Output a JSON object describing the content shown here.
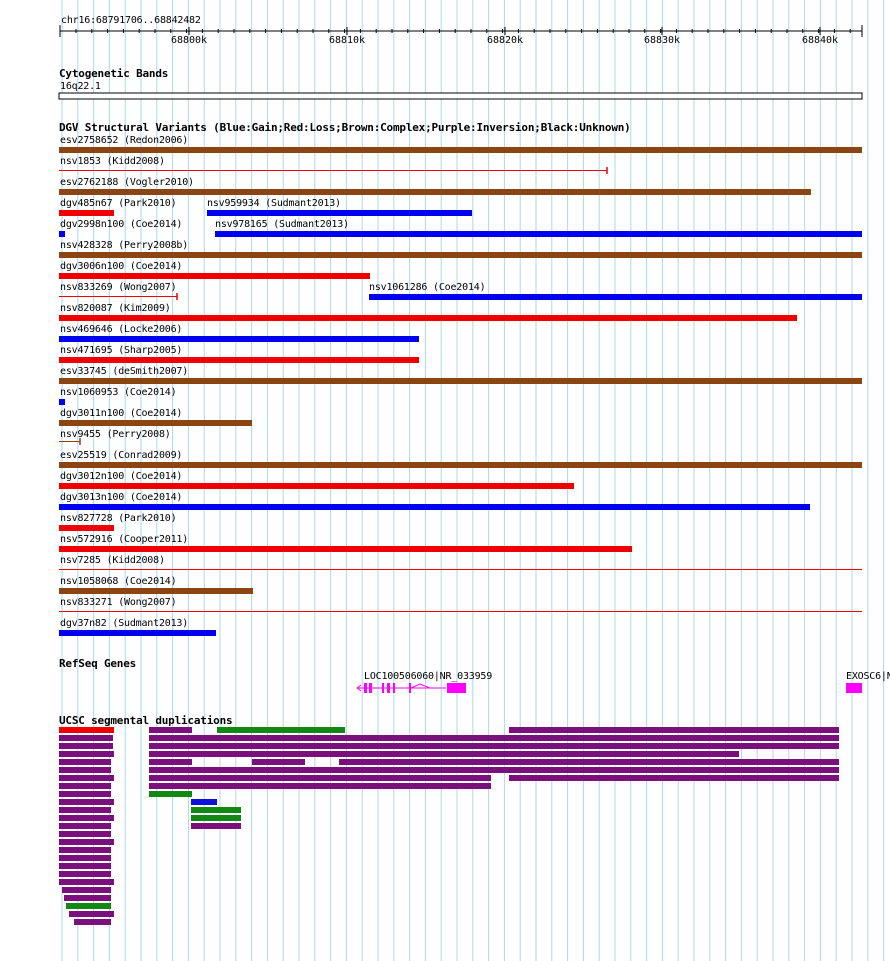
{
  "coordinates": "chr16:68791706..68842482",
  "ruler": {
    "ticks": [
      "68800k",
      "68810k",
      "68820k",
      "68830k",
      "68840k"
    ]
  },
  "cytoband": {
    "title": "Cytogenetic Bands",
    "band": "16q22.1"
  },
  "dgv": {
    "title": "DGV Structural Variants (Blue:Gain;Red:Loss;Brown:Complex;Purple:Inversion;Black:Unknown)",
    "colors": {
      "gain": "#0000ee",
      "loss": "#ee0000",
      "complex": "#8b4513",
      "purple": "#800080",
      "unknown": "#000000"
    },
    "features": [
      {
        "label": "esv2758652 (Redon2006)",
        "type": "complex"
      },
      {
        "label": "nsv1853 (Kidd2008)",
        "type": "loss"
      },
      {
        "label": "esv2762188 (Vogler2010)",
        "type": "complex"
      },
      {
        "label": "dgv485n67 (Park2010)",
        "type": "loss"
      },
      {
        "label": "nsv959934 (Sudmant2013)",
        "type": "gain"
      },
      {
        "label": "dgv2998n100 (Coe2014)",
        "type": "gain"
      },
      {
        "label": "nsv978165 (Sudmant2013)",
        "type": "gain"
      },
      {
        "label": "nsv428328 (Perry2008b)",
        "type": "complex"
      },
      {
        "label": "dgv3006n100 (Coe2014)",
        "type": "loss"
      },
      {
        "label": "nsv833269 (Wong2007)",
        "type": "loss"
      },
      {
        "label": "nsv1061286 (Coe2014)",
        "type": "gain"
      },
      {
        "label": "nsv820087 (Kim2009)",
        "type": "loss"
      },
      {
        "label": "nsv469646 (Locke2006)",
        "type": "gain"
      },
      {
        "label": "nsv471695 (Sharp2005)",
        "type": "loss"
      },
      {
        "label": "esv33745 (deSmith2007)",
        "type": "complex"
      },
      {
        "label": "nsv1060953 (Coe2014)",
        "type": "gain"
      },
      {
        "label": "dgv3011n100 (Coe2014)",
        "type": "complex"
      },
      {
        "label": "nsv9455 (Perry2008)",
        "type": "complex"
      },
      {
        "label": "esv25519 (Conrad2009)",
        "type": "complex"
      },
      {
        "label": "dgv3012n100 (Coe2014)",
        "type": "loss"
      },
      {
        "label": "dgv3013n100 (Coe2014)",
        "type": "gain"
      },
      {
        "label": "nsv827728 (Park2010)",
        "type": "loss"
      },
      {
        "label": "nsv572916 (Cooper2011)",
        "type": "loss"
      },
      {
        "label": "nsv7285 (Kidd2008)",
        "type": "loss"
      },
      {
        "label": "nsv1058068 (Coe2014)",
        "type": "complex"
      },
      {
        "label": "nsv833271 (Wong2007)",
        "type": "loss"
      },
      {
        "label": "dgv37n82 (Sudmant2013)",
        "type": "gain"
      }
    ]
  },
  "refseq": {
    "title": "RefSeq Genes",
    "genes": [
      {
        "label": "LOC100506060|NR_033959"
      },
      {
        "label": "EXOSC6|N"
      }
    ],
    "color": "#ff00ff"
  },
  "segdup": {
    "title": "UCSC segmental duplications",
    "colors": {
      "purple": "#7b0f7b",
      "red": "#ee0000",
      "green": "#118811",
      "blue": "#1010dd"
    }
  }
}
